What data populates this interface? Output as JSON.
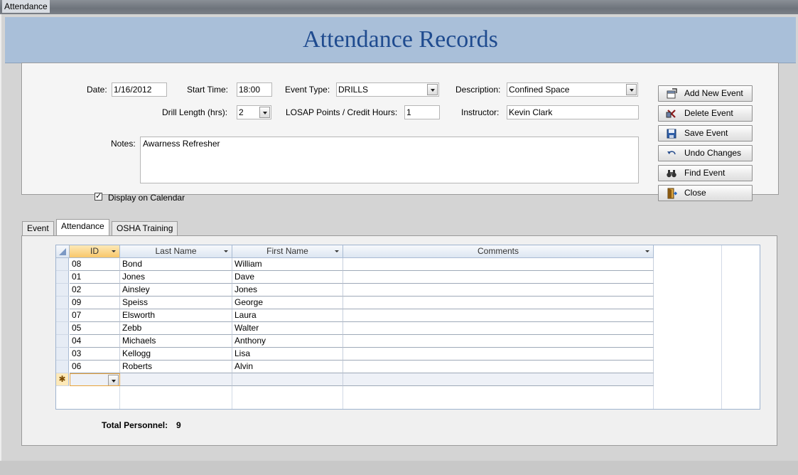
{
  "window": {
    "title": "Attendance"
  },
  "header": {
    "title": "Attendance Records"
  },
  "form": {
    "date_label": "Date:",
    "date_value": "1/16/2012",
    "start_time_label": "Start Time:",
    "start_time_value": "18:00",
    "event_type_label": "Event Type:",
    "event_type_value": "DRILLS",
    "description_label": "Description:",
    "description_value": "Confined Space",
    "drill_length_label": "Drill Length (hrs):",
    "drill_length_value": "2",
    "losap_label": "LOSAP Points / Credit Hours:",
    "losap_value": "1",
    "instructor_label": "Instructor:",
    "instructor_value": "Kevin Clark",
    "notes_label": "Notes:",
    "notes_value": "Awarness Refresher",
    "calendar_label": "Display on Calendar",
    "calendar_checked": true
  },
  "buttons": {
    "add": "Add New Event",
    "delete": "Delete Event",
    "save": "Save Event",
    "undo": "Undo Changes",
    "find": "Find Event",
    "close": "Close"
  },
  "tabs": [
    "Event",
    "Attendance",
    "OSHA Training"
  ],
  "grid": {
    "columns": [
      "ID",
      "Last Name",
      "First Name",
      "Comments"
    ],
    "rows": [
      [
        "08",
        "Bond",
        "William",
        ""
      ],
      [
        "01",
        "Jones",
        "Dave",
        ""
      ],
      [
        "02",
        "Ainsley",
        "Jones",
        ""
      ],
      [
        "09",
        "Speiss",
        "George",
        ""
      ],
      [
        "07",
        "Elsworth",
        "Laura",
        ""
      ],
      [
        "05",
        "Zebb",
        "Walter",
        ""
      ],
      [
        "04",
        "Michaels",
        "Anthony",
        ""
      ],
      [
        "03",
        "Kellogg",
        "Lisa",
        ""
      ],
      [
        "06",
        "Roberts",
        "Alvin",
        ""
      ]
    ],
    "new_row_marker": "✱"
  },
  "totals": {
    "label": "Total Personnel:",
    "value": "9"
  },
  "colors": {
    "header_bg": "#a9bfd9",
    "title_text": "#1f4b8f",
    "selected_header": "#f8c76a"
  }
}
